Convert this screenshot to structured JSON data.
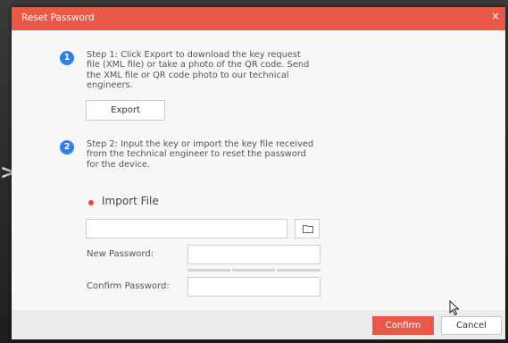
{
  "dialog": {
    "title": "Reset Password",
    "close_glyph": "×"
  },
  "step1": {
    "number": "1",
    "lines": [
      "Step 1: Click Export to download the key request",
      "file (XML file) or take a photo of the QR code. Send",
      "the XML file or QR code photo to our technical",
      "engineers."
    ],
    "export_label": "Export"
  },
  "step2": {
    "number": "2",
    "lines": [
      "Step 2: Input the key or import the key file received",
      "from the technical engineer to reset the password",
      "for the device."
    ],
    "import_option_label": "Import File",
    "import_file_value": "",
    "browse_icon": "folder-icon"
  },
  "form": {
    "new_password_label": "New Password:",
    "new_password_value": "",
    "confirm_password_label": "Confirm Password:",
    "confirm_password_value": ""
  },
  "footer": {
    "confirm_label": "Confirm",
    "cancel_label": "Cancel"
  },
  "colors": {
    "titlebar": "#e8594a",
    "step_badge": "#2f80e4",
    "radio_selected": "#e34a3a",
    "confirm_button": "#e8594a"
  }
}
